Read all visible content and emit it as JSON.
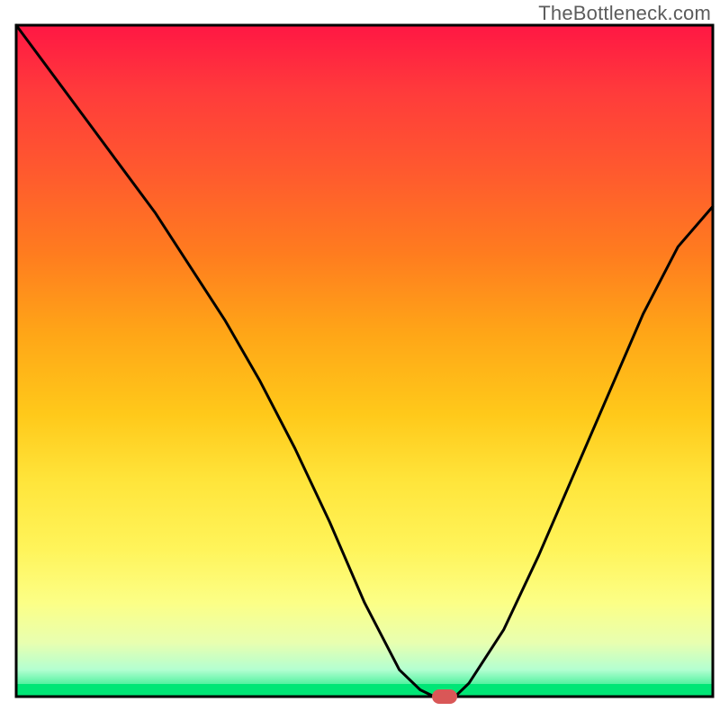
{
  "watermark": "TheBottleneck.com",
  "chart_data": {
    "type": "line",
    "title": "",
    "xlabel": "",
    "ylabel": "",
    "xlim": [
      0,
      100
    ],
    "ylim": [
      0,
      100
    ],
    "x": [
      0,
      5,
      10,
      15,
      20,
      25,
      30,
      35,
      40,
      45,
      50,
      55,
      58,
      60,
      63,
      65,
      70,
      75,
      80,
      85,
      90,
      95,
      100
    ],
    "y": [
      100,
      93,
      86,
      79,
      72,
      64,
      56,
      47,
      37,
      26,
      14,
      4,
      1,
      0,
      0,
      2,
      10,
      21,
      33,
      45,
      57,
      67,
      73
    ],
    "minimum_marker": {
      "x": 61.5,
      "y": 0
    },
    "gradient_bands": [
      {
        "color": "#ff1744",
        "stop": 0.0
      },
      {
        "color": "#ff3b3b",
        "stop": 0.1
      },
      {
        "color": "#ff5a2e",
        "stop": 0.22
      },
      {
        "color": "#ff7c1f",
        "stop": 0.34
      },
      {
        "color": "#ffa617",
        "stop": 0.46
      },
      {
        "color": "#ffc91a",
        "stop": 0.58
      },
      {
        "color": "#ffe53b",
        "stop": 0.68
      },
      {
        "color": "#fff45a",
        "stop": 0.78
      },
      {
        "color": "#fcff86",
        "stop": 0.86
      },
      {
        "color": "#e8ffb0",
        "stop": 0.92
      },
      {
        "color": "#b3ffd1",
        "stop": 0.96
      },
      {
        "color": "#00e676",
        "stop": 1.0
      }
    ],
    "frame_color": "#000000",
    "curve_color": "#000000",
    "marker_color": "#d95757"
  }
}
